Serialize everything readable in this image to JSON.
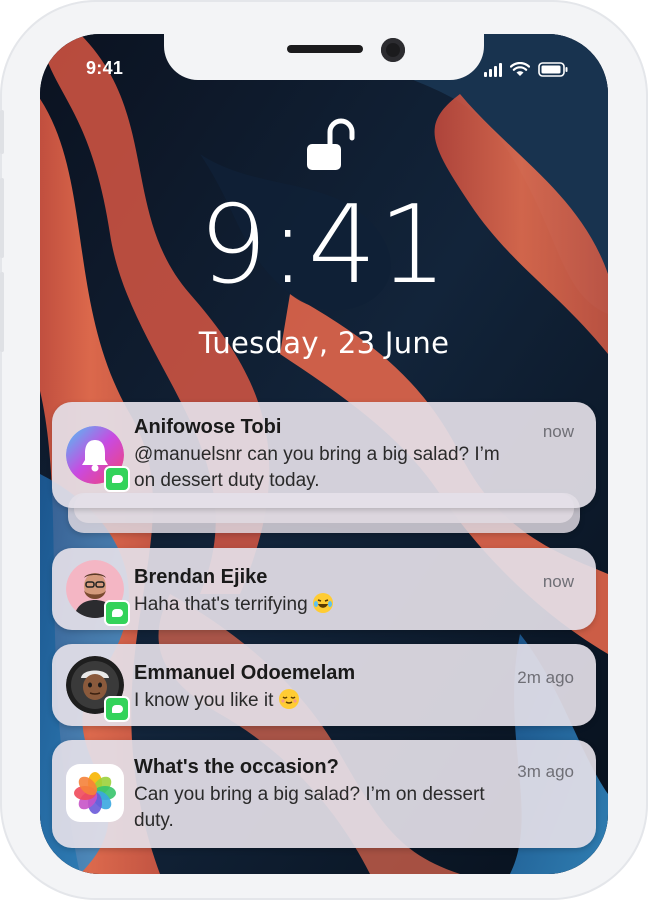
{
  "status_bar": {
    "time": "9:41"
  },
  "lockscreen": {
    "time": "9:41",
    "date": "Tuesday,  23 June"
  },
  "notifications": [
    {
      "title": "Anifowose Tobi",
      "time": "now",
      "line1": "@manuelsnr can you bring a big salad? I’m",
      "line2": "on dessert duty today.",
      "icon": "bell-app-icon",
      "badge": "messages-icon"
    },
    {
      "title": "Brendan Ejike",
      "time": "now",
      "line1": "Haha that's terrifying",
      "emoji": "laughing-tears-emoji",
      "icon": "avatar-brendan",
      "badge": "messages-icon"
    },
    {
      "title": "Emmanuel Odoemelam",
      "time": "2m ago",
      "line1": "I know you like it",
      "emoji": "relieved-face-emoji",
      "icon": "avatar-emmanuel",
      "badge": "messages-icon"
    },
    {
      "title": "What's the occasion?",
      "time": "3m ago",
      "line1": "Can you bring a big salad? I’m on dessert",
      "line2": "duty.",
      "icon": "photos-app-icon"
    }
  ],
  "colors": {
    "wallpaper_dark": "#0c1626",
    "wallpaper_orange": "#f0654a",
    "wallpaper_blue": "#2a7fc4",
    "badge_green": "#33d35a",
    "frame": "#f3f4f6"
  }
}
